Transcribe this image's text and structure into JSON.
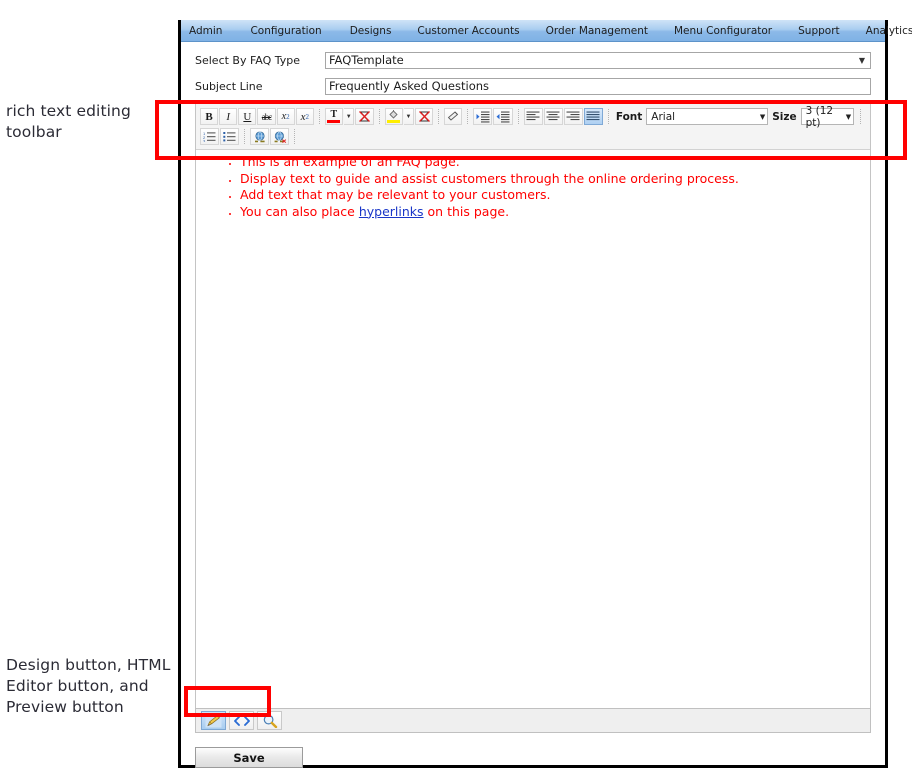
{
  "annotations": {
    "toolbar_callout": "rich text editing toolbar",
    "buttons_callout": "Design button, HTML Editor button, and Preview button"
  },
  "nav": {
    "items": [
      {
        "label": "Admin"
      },
      {
        "label": "Configuration"
      },
      {
        "label": "Designs"
      },
      {
        "label": "Customer Accounts"
      },
      {
        "label": "Order Management"
      },
      {
        "label": "Menu Configurator"
      },
      {
        "label": "Support"
      },
      {
        "label": "Analytics"
      }
    ]
  },
  "form": {
    "faq_type": {
      "label": "Select By FAQ Type",
      "value": "FAQTemplate",
      "caret": "▼"
    },
    "subject_line": {
      "label": "Subject Line",
      "value": "Frequently Asked Questions"
    }
  },
  "toolbar": {
    "row1": [
      {
        "name": "bold-button",
        "glyph": "B",
        "title": "Bold"
      },
      {
        "name": "italic-button",
        "glyph": "I",
        "title": "Italic"
      },
      {
        "name": "underline-button",
        "glyph": "U",
        "title": "Underline"
      },
      {
        "name": "strikethrough-button",
        "glyph": "abc",
        "title": "Strikethrough"
      },
      {
        "name": "subscript-button",
        "glyph": "x",
        "sub": "2",
        "title": "Subscript"
      },
      {
        "name": "superscript-button",
        "glyph": "x",
        "sup": "2",
        "title": "Superscript"
      }
    ],
    "text_color": {
      "name": "text-color-button",
      "glyph": "T",
      "swatch": "#ff0000",
      "title": "Text Color"
    },
    "remove_text_color": {
      "name": "remove-text-color-button",
      "title": "Remove Text Color"
    },
    "background_color": {
      "name": "background-color-button",
      "swatch": "#ffee00",
      "title": "Background Color"
    },
    "remove_background_color": {
      "name": "remove-background-color-button",
      "title": "Remove Background Color"
    },
    "eraser": {
      "name": "remove-format-button",
      "title": "Remove Format"
    },
    "indent": {
      "name": "indent-button",
      "title": "Increase Indent"
    },
    "outdent": {
      "name": "outdent-button",
      "title": "Decrease Indent"
    },
    "align": [
      {
        "name": "align-left-button",
        "title": "Align Left",
        "active": false
      },
      {
        "name": "align-center-button",
        "title": "Align Center",
        "active": false
      },
      {
        "name": "align-right-button",
        "title": "Align Right",
        "active": false
      },
      {
        "name": "align-justify-button",
        "title": "Justify",
        "active": true
      }
    ],
    "font": {
      "label": "Font",
      "value": "Arial",
      "caret": "▼"
    },
    "size": {
      "label": "Size",
      "value": "3 (12 pt)",
      "caret": "▼"
    },
    "row2": [
      {
        "name": "numbered-list-button",
        "title": "Numbered List"
      },
      {
        "name": "bulleted-list-button",
        "title": "Bulleted List"
      },
      {
        "name": "insert-link-button",
        "title": "Insert Link"
      },
      {
        "name": "remove-link-button",
        "title": "Remove Link"
      }
    ]
  },
  "content": {
    "bullets": [
      {
        "pre": "This is an example of an FAQ page.",
        "link": "",
        "post": ""
      },
      {
        "pre": "Display text to guide and assist customers through the online ordering process.",
        "link": "",
        "post": ""
      },
      {
        "pre": "Add text that may be relevant to your customers.",
        "link": "",
        "post": ""
      },
      {
        "pre": "You can also place ",
        "link": "hyperlinks",
        "post": " on this page."
      }
    ],
    "text_color": "#ff0000",
    "link_color": "#1936c8"
  },
  "mode_bar": {
    "buttons": [
      {
        "name": "design-mode-button",
        "label": "Design",
        "active": true
      },
      {
        "name": "html-editor-mode-button",
        "label": "HTML Editor",
        "active": false
      },
      {
        "name": "preview-mode-button",
        "label": "Preview",
        "active": false
      }
    ]
  },
  "save": {
    "label": "Save"
  },
  "colors": {
    "nav_top": "#cfe3f7",
    "nav_bottom": "#7fb2e5",
    "highlight_red": "#ff0000",
    "accent_blue": "#2b5fa8"
  }
}
